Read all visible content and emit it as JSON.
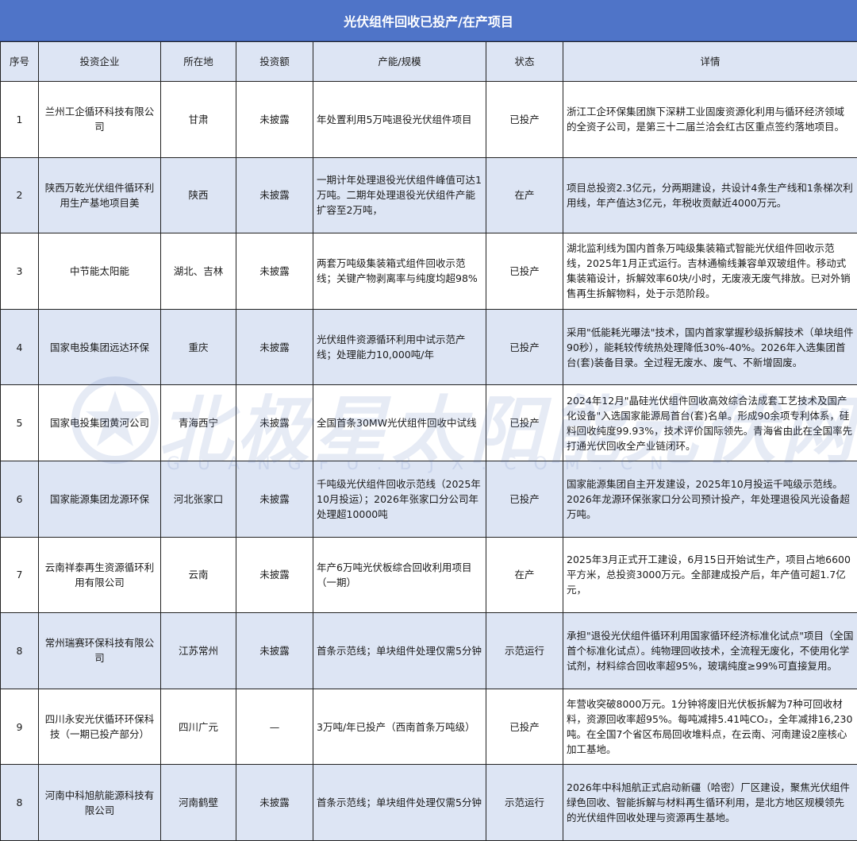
{
  "title": "光伏组件回收已投产/在产项目",
  "headers": [
    "序号",
    "投资企业",
    "所在地",
    "投资额",
    "产能/规模",
    "状态",
    "详情"
  ],
  "rows": [
    {
      "no": "1",
      "company": "兰州工企循环科技有限公司",
      "location": "甘肃",
      "investment": "未披露",
      "capacity": "年处置利用5万吨退役光伏组件项目",
      "status": "已投产",
      "detail": "浙江工企环保集团旗下深耕工业固废资源化利用与循环经济领域的全资子公司，是第三十二届兰洽会红古区重点签约落地项目。"
    },
    {
      "no": "2",
      "company": "陕西万乾光伏组件循环利用生产基地项目美",
      "location": "陕西",
      "investment": "未披露",
      "capacity": "一期计年处理退役光伏组件峰值可达1万吨。二期年处理退役光伏组件产能扩容至2万吨，",
      "status": "在产",
      "detail": "项目总投资2.3亿元，分两期建设，共设计4条生产线和1条梯次利用线，年产值达3亿元，年税收贡献近4000万元。"
    },
    {
      "no": "3",
      "company": "中节能太阳能",
      "location": "湖北、吉林",
      "investment": "未披露",
      "capacity": "两套万吨级集装箱式组件回收示范线；关键产物剥离率与纯度均超98%",
      "status": "已投产",
      "detail": "湖北监利线为国内首条万吨级集装箱式智能光伏组件回收示范线，2025年1月正式运行。吉林通榆线兼容单双玻组件。移动式集装箱设计，拆解效率60块/小时，无废液无废气排放。已对外销售再生拆解物料，处于示范阶段。"
    },
    {
      "no": "4",
      "company": "国家电投集团远达环保",
      "location": "重庆",
      "investment": "未披露",
      "capacity": "光伏组件资源循环利用中试示范产线；处理能力10,000吨/年",
      "status": "已投产",
      "detail": "采用\"低能耗光曝法\"技术，国内首家掌握秒级拆解技术（单块组件90秒），能耗较传统热处理降低30%-40%。2026年入选集团首台(套)装备目录。全过程无废水、废气、不新增固废。"
    },
    {
      "no": "5",
      "company": "国家电投集团黄河公司",
      "location": "青海西宁",
      "investment": "未披露",
      "capacity": "全国首条30MW光伏组件回收中试线",
      "status": "已投产",
      "detail": "2024年12月\"晶硅光伏组件回收高效综合法成套工艺技术及国产化设备\"入选国家能源局首台(套)名单。形成90余项专利体系，硅料回收纯度99.93%，技术评价国际领先。青海省由此在全国率先打通光伏回收全产业链闭环。"
    },
    {
      "no": "6",
      "company": "国家能源集团龙源环保",
      "location": "河北张家口",
      "investment": "未披露",
      "capacity": "千吨级光伏组件回收示范线（2025年10月投运）；2026年张家口分公司年处理超10000吨",
      "status": "已投产",
      "detail": "国家能源集团自主开发建设，2025年10月投运千吨级示范线。2026年龙源环保张家口分公司预计投产，年处理退役风光设备超万吨。"
    },
    {
      "no": "7",
      "company": "云南祥泰再生资源循环利用有限公司",
      "location": "云南",
      "investment": "未披露",
      "capacity": "年产6万吨光伏板综合回收利用项目（一期）",
      "status": "在产",
      "detail": "2025年3月正式开工建设，6月15日开始试生产，项目占地6600平方米，总投资3000万元。全部建成投产后，年产值可超1.7亿元，"
    },
    {
      "no": "8",
      "company": "常州瑞赛环保科技有限公司",
      "location": "江苏常州",
      "investment": "未披露",
      "capacity": "首条示范线；单块组件处理仅需5分钟",
      "status": "示范运行",
      "detail": "承担\"退役光伏组件循环利用国家循环经济标准化试点\"项目（全国首个标准化试点）。纯物理回收技术，全流程无废化，不使用化学试剂，材料综合回收率超95%，玻璃纯度≥99%可直接复用。"
    },
    {
      "no": "9",
      "company": "四川永安光伏循环环保科技（一期已投产部分）",
      "location": "四川广元",
      "investment": "—",
      "capacity": "3万吨/年已投产（西南首条万吨级）",
      "status": "已投产",
      "detail": "年营收突破8000万元。1分钟将废旧光伏板拆解为7种可回收材料，资源回收率超95%。每吨减排5.41吨CO₂，全年减排16,230吨。在全国7个省区布局回收堆料点，在云南、河南建设2座核心加工基地。"
    },
    {
      "no": "8",
      "company": "河南中科旭航能源科技有限公司",
      "location": "河南鹤壁",
      "investment": "未披露",
      "capacity": "首条示范线；单块组件处理仅需5分钟",
      "status": "示范运行",
      "detail": "2026年中科旭航正式启动新疆（哈密）厂区建设，聚焦光伏组件绿色回收、智能拆解与材料再生循环利用，是北方地区规模领先的光伏组件回收处理与资源再生基地。"
    }
  ],
  "watermark": {
    "text": "北极星太阳能光伏网",
    "subtext": "GUANGFU.BJX.COM.CN"
  },
  "colors": {
    "title_bg": "#4f74c8",
    "stripe": "#dde5f4"
  }
}
